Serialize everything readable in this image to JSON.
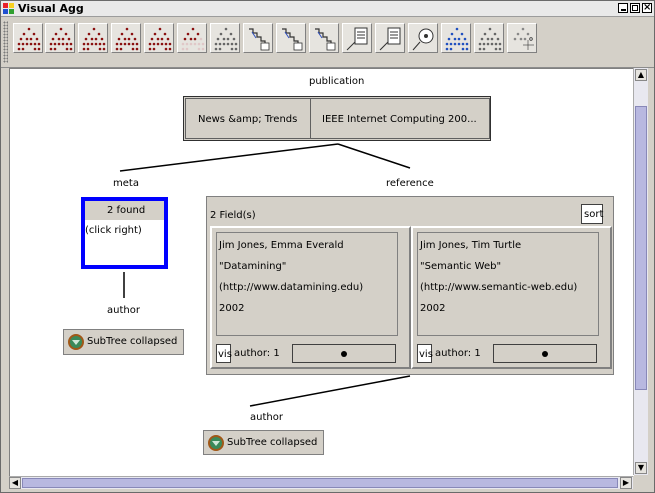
{
  "window": {
    "title": "Visual Agg"
  },
  "toolbar": {
    "buttons": [
      {
        "icon": "tree-red-icon"
      },
      {
        "icon": "tree-red-icon"
      },
      {
        "icon": "tree-red-icon"
      },
      {
        "icon": "tree-red-icon"
      },
      {
        "icon": "tree-red-icon"
      },
      {
        "icon": "tree-partial-icon"
      },
      {
        "icon": "tree-grey-icon"
      },
      {
        "icon": "staircase-icon"
      },
      {
        "icon": "staircase-icon"
      },
      {
        "icon": "staircase-icon"
      },
      {
        "icon": "document-link-icon"
      },
      {
        "icon": "document-link-icon"
      },
      {
        "icon": "disk-link-icon"
      },
      {
        "icon": "tree-blue-icon"
      },
      {
        "icon": "tree-grey-icon"
      },
      {
        "icon": "tree-table-icon"
      }
    ]
  },
  "graph": {
    "root_label": "publication",
    "root_fields": [
      "News &amp; Trends",
      "IEEE Internet Computing 200..."
    ],
    "meta": {
      "label": "meta",
      "header": "2 found",
      "hint": "(click right)"
    },
    "meta_child_label": "author",
    "meta_child_collapsed": "SubTree collapsed",
    "reference": {
      "label": "reference",
      "count_text": "2 Field(s)",
      "sort_label": "sort",
      "items": [
        {
          "authors": "Jim Jones, Emma Everald",
          "title": "\"Datamining\"",
          "url": "(http://www.datamining.edu)",
          "year": "2002",
          "vis_label": "vis",
          "author_count": "author: 1"
        },
        {
          "authors": "Jim Jones, Tim Turtle",
          "title": "\"Semantic Web\"",
          "url": "(http://www.semantic-web.edu)",
          "year": "2002",
          "vis_label": "vis",
          "author_count": "author: 1"
        }
      ]
    },
    "ref_child_label": "author",
    "ref_child_collapsed": "SubTree collapsed"
  },
  "colors": {
    "selection_border": "#0000ff",
    "scroll_thumb": "#b8b8e0"
  }
}
